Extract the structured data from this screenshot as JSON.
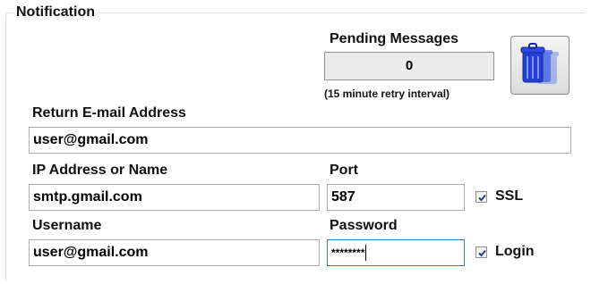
{
  "notification": {
    "title": "Notification",
    "pending": {
      "label": "Pending Messages",
      "value": "0",
      "retry_note": "(15 minute retry interval)"
    },
    "purge_button": {
      "icon": "trash-bin-icon"
    },
    "return_email": {
      "label": "Return E-mail Address",
      "value": "user@gmail.com"
    },
    "server": {
      "label": "IP Address or Name",
      "value": "smtp.gmail.com"
    },
    "port": {
      "label": "Port",
      "value": "587"
    },
    "ssl": {
      "label": "SSL",
      "checked": true
    },
    "username": {
      "label": "Username",
      "value": "user@gmail.com"
    },
    "password": {
      "label": "Password",
      "value": "********"
    },
    "login": {
      "label": "Login",
      "checked": true
    }
  },
  "colors": {
    "group_border": "#d5dfe5",
    "input_border": "#abadb3",
    "focus_border": "#3d7bad",
    "trash_blue": "#2b4bd8"
  }
}
